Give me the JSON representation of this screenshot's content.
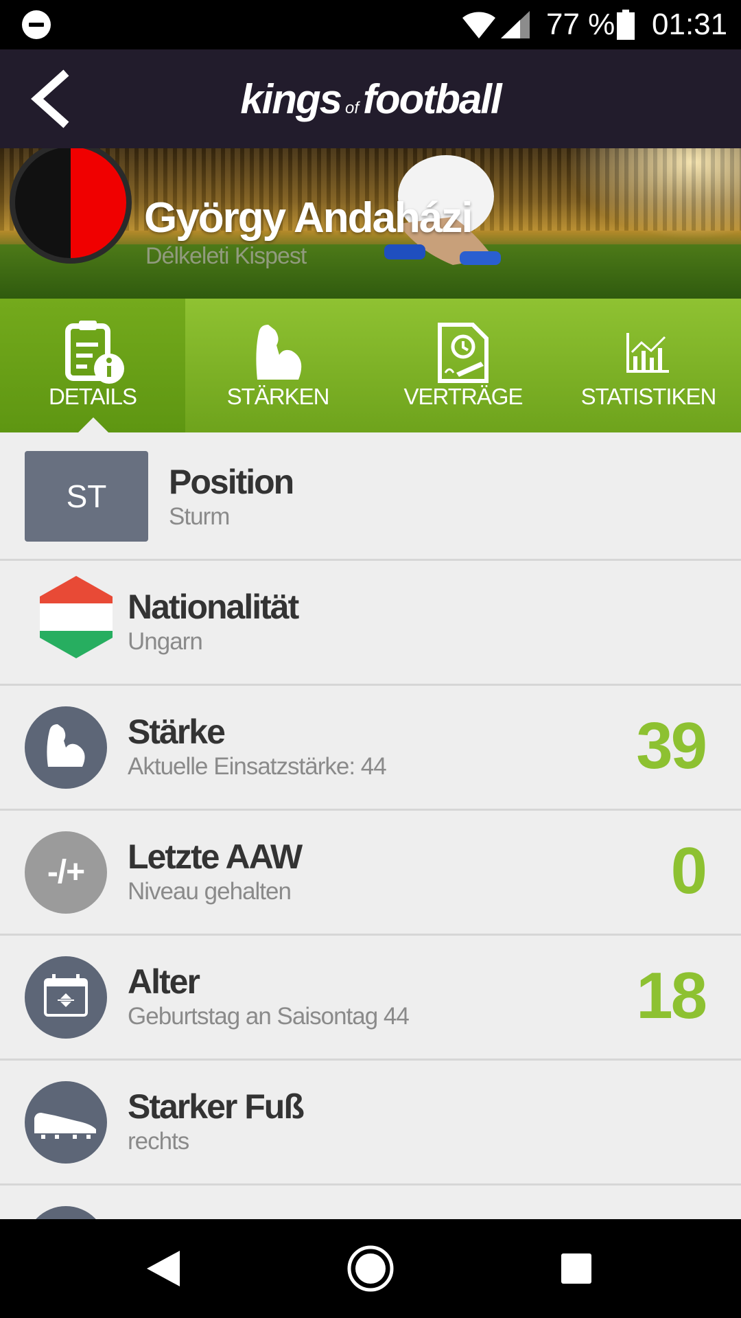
{
  "status_bar": {
    "battery_percent": "77 %",
    "time": "01:31",
    "icons": [
      "do-not-disturb-icon",
      "wifi-icon",
      "signal-icon",
      "battery-icon"
    ]
  },
  "header": {
    "logo_part1": "kings",
    "logo_part2": "of",
    "logo_part3": "football",
    "back_icon": "back-arrow-icon"
  },
  "player": {
    "name": "György Andaházi",
    "club": "Délkeleti Kispest",
    "club_colors": [
      "#111111",
      "#f00000"
    ]
  },
  "tabs": [
    {
      "label": "DETAILS",
      "icon": "details-document-icon",
      "active": true
    },
    {
      "label": "STÄRKEN",
      "icon": "flexed-arm-icon",
      "active": false
    },
    {
      "label": "VERTRÄGE",
      "icon": "contract-icon",
      "active": false
    },
    {
      "label": "STATISTIKEN",
      "icon": "chart-icon",
      "active": false
    }
  ],
  "details": {
    "position": {
      "badge": "ST",
      "title": "Position",
      "subtitle": "Sturm"
    },
    "nationality": {
      "title": "Nationalität",
      "subtitle": "Ungarn",
      "flag_colors": [
        "#e84a36",
        "#ffffff",
        "#27ae60"
      ]
    },
    "strength": {
      "title": "Stärke",
      "subtitle": "Aktuelle Einsatzstärke: 44",
      "value": "39",
      "icon": "flexed-arm-icon"
    },
    "last_aaw": {
      "title": "Letzte AAW",
      "subtitle": "Niveau gehalten",
      "value": "0",
      "badge": "-/+"
    },
    "age": {
      "title": "Alter",
      "subtitle": "Geburtstag an Saisontag 44",
      "value": "18",
      "icon": "calendar-icon"
    },
    "strong_foot": {
      "title": "Starker Fuß",
      "subtitle": "rechts",
      "icon": "football-boot-icon"
    }
  },
  "colors": {
    "accent_green": "#8dc131",
    "header_bg": "#221c2c",
    "icon_bg": "#5d6677"
  },
  "nav": {
    "icons": [
      "back-triangle-icon",
      "home-circle-icon",
      "recents-square-icon"
    ]
  }
}
